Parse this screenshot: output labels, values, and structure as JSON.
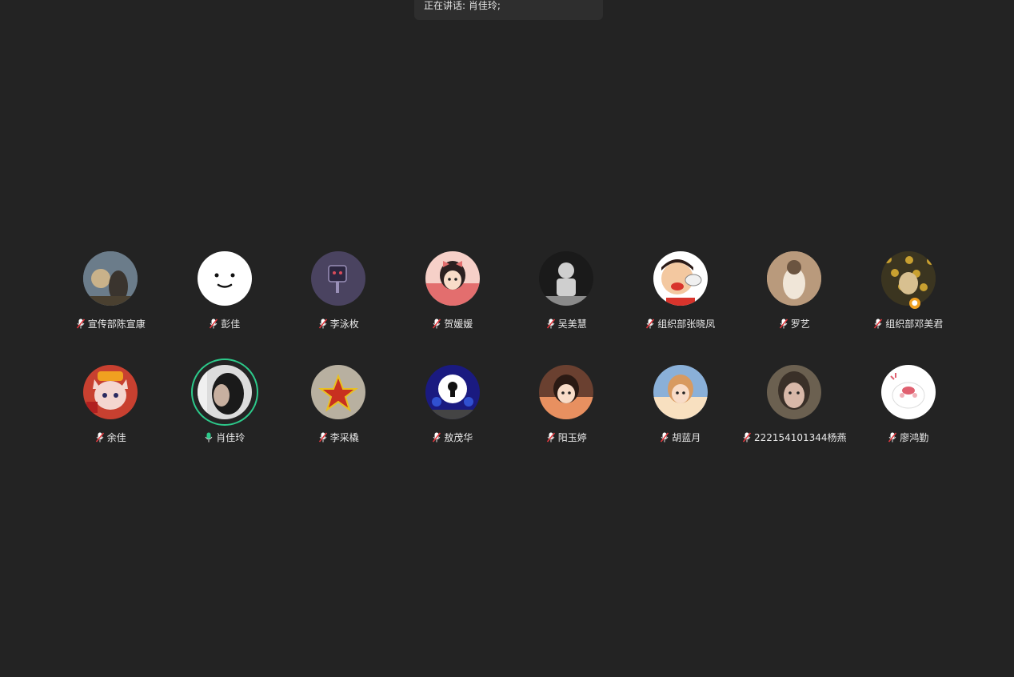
{
  "banner": {
    "prefix": "正在讲话:",
    "speaker": "肖佳玲;"
  },
  "participants": [
    {
      "name": "宣传部陈宣康",
      "muted": true,
      "speaking": false,
      "host": false,
      "avatar": "photo-person-sunset-icon",
      "colors": [
        "#6b7c8a",
        "#c9b28a",
        "#3a342e"
      ]
    },
    {
      "name": "彭佳",
      "muted": true,
      "speaking": false,
      "host": false,
      "avatar": "smiley-face-icon",
      "colors": [
        "#ffffff",
        "#111111",
        "#ffffff"
      ]
    },
    {
      "name": "李泳枚",
      "muted": true,
      "speaking": false,
      "host": false,
      "avatar": "robot-tv-icon",
      "colors": [
        "#4a4360",
        "#2c2640",
        "#d94b5a"
      ]
    },
    {
      "name": "贺媛媛",
      "muted": true,
      "speaking": false,
      "host": false,
      "avatar": "anime-girl-bow-icon",
      "colors": [
        "#f6d0c8",
        "#e36e6e",
        "#2b2020"
      ]
    },
    {
      "name": "吴美慧",
      "muted": true,
      "speaking": false,
      "host": false,
      "avatar": "astronaut-icon",
      "colors": [
        "#1a1a1a",
        "#cfcfcf",
        "#8a8a8a"
      ]
    },
    {
      "name": "组织部张晓凤",
      "muted": true,
      "speaking": false,
      "host": false,
      "avatar": "cartoon-boy-eating-icon",
      "colors": [
        "#ffffff",
        "#d8342c",
        "#2b1a16"
      ]
    },
    {
      "name": "罗艺",
      "muted": true,
      "speaking": false,
      "host": false,
      "avatar": "baby-photo-icon",
      "colors": [
        "#b99a7c",
        "#f0e6d8",
        "#6b5440"
      ]
    },
    {
      "name": "组织部邓美君",
      "muted": true,
      "speaking": false,
      "host": true,
      "avatar": "photo-flowers-icon",
      "colors": [
        "#3b3520",
        "#c8a030",
        "#d8c090"
      ]
    },
    {
      "name": "余佳",
      "muted": true,
      "speaking": false,
      "host": false,
      "avatar": "tiger-cat-icon",
      "colors": [
        "#c84030",
        "#f4d6d0",
        "#ffffff"
      ]
    },
    {
      "name": "肖佳玲",
      "muted": false,
      "speaking": true,
      "host": false,
      "avatar": "girl-hood-photo-icon",
      "colors": [
        "#dcdcdc",
        "#4a4a4a",
        "#1a1a1a"
      ]
    },
    {
      "name": "李采橇",
      "muted": true,
      "speaking": false,
      "host": false,
      "avatar": "red-star-icon",
      "colors": [
        "#b8b0a0",
        "#e8c020",
        "#c83020"
      ]
    },
    {
      "name": "敖茂华",
      "muted": true,
      "speaking": false,
      "host": false,
      "avatar": "keyhole-ghost-icon",
      "colors": [
        "#1a1a80",
        "#ffffff",
        "#3050d0"
      ]
    },
    {
      "name": "阳玉婷",
      "muted": true,
      "speaking": false,
      "host": false,
      "avatar": "anime-girl-sunset-icon",
      "colors": [
        "#6a4030",
        "#e89060",
        "#2a1a14"
      ]
    },
    {
      "name": "胡蓝月",
      "muted": true,
      "speaking": false,
      "host": false,
      "avatar": "anime-girl-sky-icon",
      "colors": [
        "#8ab0d8",
        "#f8e0c0",
        "#d89a60"
      ]
    },
    {
      "name": "222154101344杨燕",
      "muted": true,
      "speaking": false,
      "host": false,
      "avatar": "girl-portrait-icon",
      "colors": [
        "#6b6050",
        "#d8b8a8",
        "#3a3028"
      ]
    },
    {
      "name": "廖鸿勤",
      "muted": true,
      "speaking": false,
      "host": false,
      "avatar": "cute-bunny-icon",
      "colors": [
        "#ffffff",
        "#f0b0b8",
        "#e06070"
      ]
    }
  ]
}
